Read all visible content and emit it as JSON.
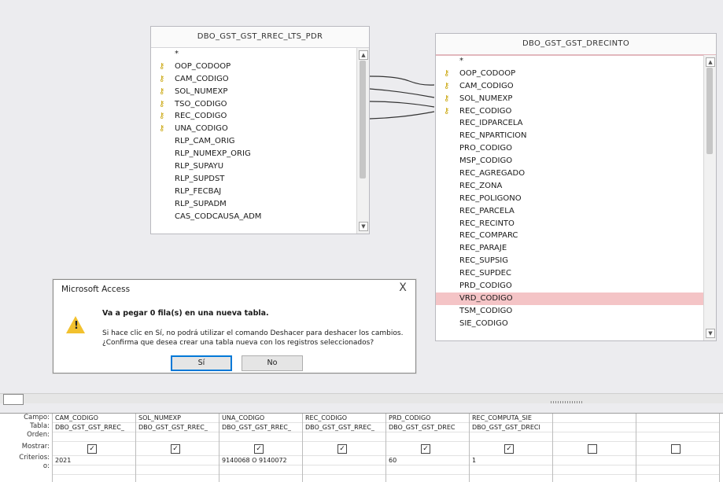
{
  "tables": [
    {
      "title": "DBO_GST_GST_RREC_LTS_PDR",
      "fields": [
        "*",
        "OOP_CODOOP",
        "CAM_CODIGO",
        "SOL_NUMEXP",
        "TSO_CODIGO",
        "REC_CODIGO",
        "UNA_CODIGO",
        "RLP_CAM_ORIG",
        "RLP_NUMEXP_ORIG",
        "RLP_SUPAYU",
        "RLP_SUPDST",
        "RLP_FECBAJ",
        "RLP_SUPADM",
        "CAS_CODCAUSA_ADM"
      ]
    },
    {
      "title": "DBO_GST_GST_DRECINTO",
      "fields": [
        "*",
        "OOP_CODOOP",
        "CAM_CODIGO",
        "SOL_NUMEXP",
        "REC_CODIGO",
        "REC_IDPARCELA",
        "REC_NPARTICION",
        "PRO_CODIGO",
        "MSP_CODIGO",
        "REC_AGREGADO",
        "REC_ZONA",
        "REC_POLIGONO",
        "REC_PARCELA",
        "REC_RECINTO",
        "REC_COMPARC",
        "REC_PARAJE",
        "REC_SUPSIG",
        "REC_SUPDEC",
        "PRD_CODIGO",
        "VRD_CODIGO",
        "TSM_CODIGO",
        "SIE_CODIGO"
      ]
    }
  ],
  "dialog": {
    "title": "Microsoft Access",
    "close_label": "X",
    "icon": "warning-icon",
    "message_main": "Va a pegar 0 fila(s) en una nueva tabla.",
    "message_detail": "Si hace clic en Sí, no podrá utilizar el comando Deshacer para deshacer los cambios. ¿Confirma que desea crear una tabla nueva con los registros seleccionados?",
    "yes_label": "Sí",
    "no_label": "No"
  },
  "grid": {
    "row_labels": [
      "Campo:",
      "Tabla:",
      "Orden:",
      "Mostrar:",
      "Criterios:",
      "o:"
    ],
    "columns": [
      {
        "field": "CAM_CODIGO",
        "table": "DBO_GST_GST_RREC_",
        "show": true,
        "criteria": "2021"
      },
      {
        "field": "SOL_NUMEXP",
        "table": "DBO_GST_GST_RREC_",
        "show": true,
        "criteria": ""
      },
      {
        "field": "UNA_CODIGO",
        "table": "DBO_GST_GST_RREC_",
        "show": true,
        "criteria": "9140068 O 9140072"
      },
      {
        "field": "REC_CODIGO",
        "table": "DBO_GST_GST_RREC_",
        "show": true,
        "criteria": ""
      },
      {
        "field": "PRD_CODIGO",
        "table": "DBO_GST_GST_DREC",
        "show": true,
        "criteria": "60"
      },
      {
        "field": "REC_COMPUTA_SIE",
        "table": "DBO_GST_GST_DRECI",
        "show": true,
        "criteria": "1"
      },
      {
        "field": "",
        "table": "",
        "show": false,
        "criteria": ""
      },
      {
        "field": "",
        "table": "",
        "show": false,
        "criteria": ""
      }
    ]
  },
  "colors": {
    "selected_row": "#f4c4c6",
    "warning": "#f2c12e",
    "key": "#c8a200",
    "default_button_border": "#0078d7"
  }
}
